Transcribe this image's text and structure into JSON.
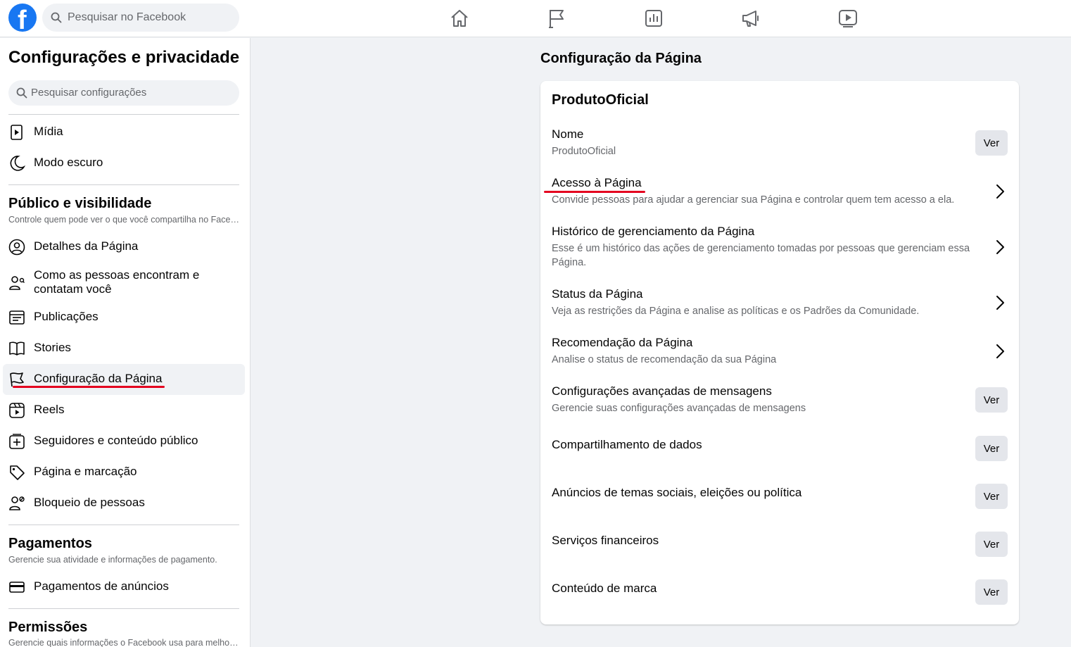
{
  "topbar": {
    "logo_letter": "f",
    "search_placeholder": "Pesquisar no Facebook",
    "nav_icons": [
      "home-icon",
      "flag-icon",
      "insights-icon",
      "megaphone-icon",
      "video-icon"
    ]
  },
  "sidebar": {
    "title": "Configurações e privacidade",
    "search_placeholder": "Pesquisar configurações",
    "top_items": [
      {
        "label": "Mídia",
        "icon": "media-icon"
      },
      {
        "label": "Modo escuro",
        "icon": "moon-icon"
      }
    ],
    "section_public": {
      "title": "Público e visibilidade",
      "subtitle": "Controle quem pode ver o que você compartilha no Facebook."
    },
    "public_items": [
      {
        "label": "Detalhes da Página",
        "icon": "profile-icon"
      },
      {
        "label": "Como as pessoas encontram e contatam você",
        "icon": "people-search-icon"
      },
      {
        "label": "Publicações",
        "icon": "posts-icon"
      },
      {
        "label": "Stories",
        "icon": "book-icon"
      },
      {
        "label": "Configuração da Página",
        "icon": "flag-icon"
      },
      {
        "label": "Reels",
        "icon": "reels-icon"
      },
      {
        "label": "Seguidores e conteúdo público",
        "icon": "add-box-icon"
      },
      {
        "label": "Página e marcação",
        "icon": "tag-icon"
      },
      {
        "label": "Bloqueio de pessoas",
        "icon": "block-person-icon"
      }
    ],
    "section_payments": {
      "title": "Pagamentos",
      "subtitle": "Gerencie sua atividade e informações de pagamento."
    },
    "payment_items": [
      {
        "label": "Pagamentos de anúncios",
        "icon": "credit-card-icon"
      }
    ],
    "section_permissions": {
      "title": "Permissões",
      "subtitle": "Gerencie quais informações o Facebook usa para melhorar sua experiência."
    }
  },
  "main": {
    "title": "Configuração da Página",
    "card_title": "ProdutoOficial",
    "button_label": "Ver",
    "rows": [
      {
        "title": "Nome",
        "desc": "ProdutoOficial",
        "action": "button"
      },
      {
        "title": "Acesso à Página",
        "desc": "Convide pessoas para ajudar a gerenciar sua Página e controlar quem tem acesso a ela.",
        "action": "chevron"
      },
      {
        "title": "Histórico de gerenciamento da Página",
        "desc": "Esse é um histórico das ações de gerenciamento tomadas por pessoas que gerenciam essa Página.",
        "action": "chevron"
      },
      {
        "title": "Status da Página",
        "desc": "Veja as restrições da Página e analise as políticas e os Padrões da Comunidade.",
        "action": "chevron"
      },
      {
        "title": "Recomendação da Página",
        "desc": "Analise o status de recomendação da sua Página",
        "action": "chevron"
      },
      {
        "title": "Configurações avançadas de mensagens",
        "desc": "Gerencie suas configurações avançadas de mensagens",
        "action": "button"
      },
      {
        "title": "Compartilhamento de dados",
        "desc": "",
        "action": "button"
      },
      {
        "title": "Anúncios de temas sociais, eleições ou política",
        "desc": "",
        "action": "button"
      },
      {
        "title": "Serviços financeiros",
        "desc": "",
        "action": "button"
      },
      {
        "title": "Conteúdo de marca",
        "desc": "",
        "action": "button"
      }
    ]
  },
  "colors": {
    "brand": "#1877f2",
    "highlight_underline": "#e4001f",
    "muted_text": "#65676b"
  }
}
